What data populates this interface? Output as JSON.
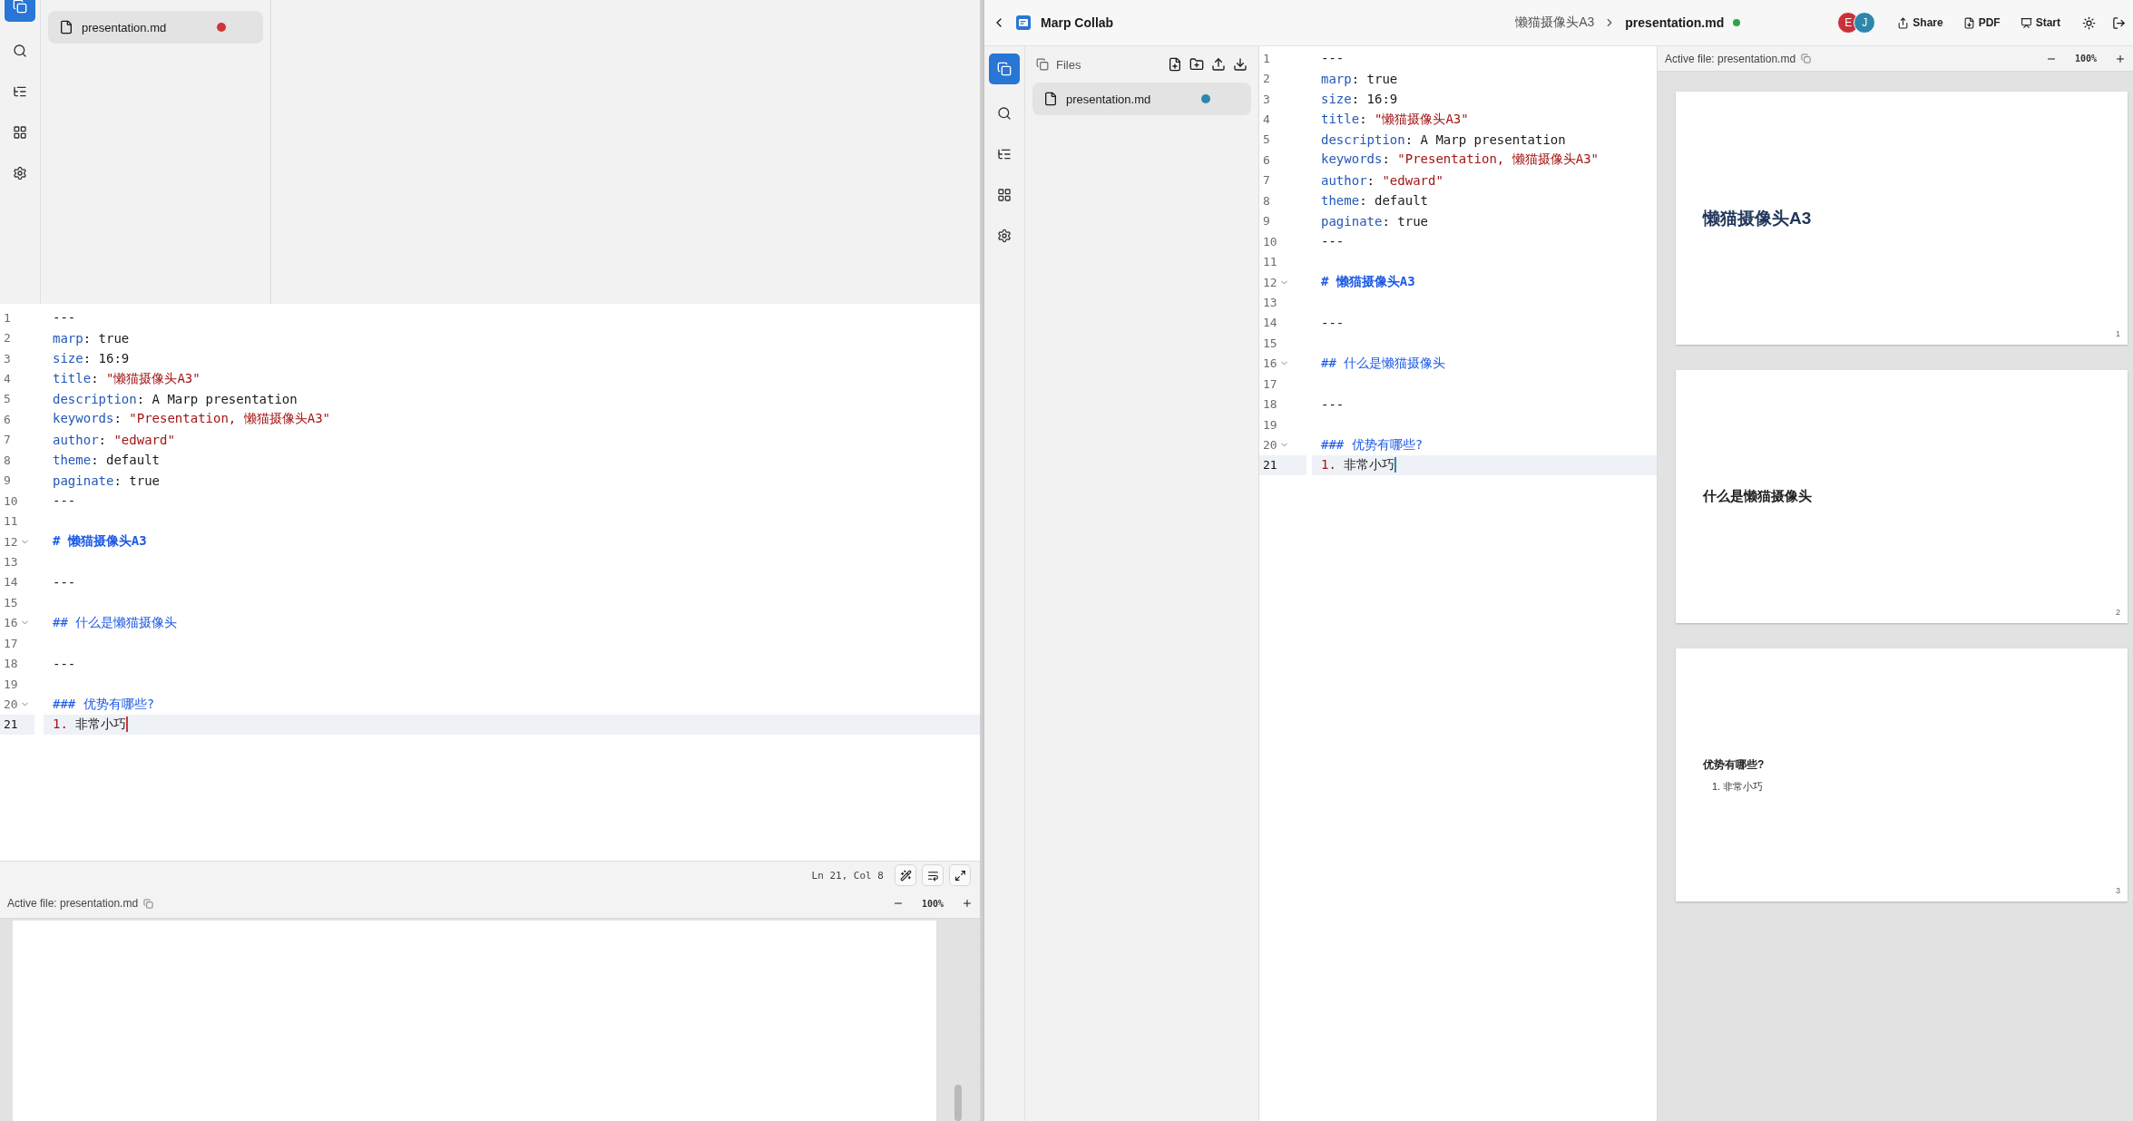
{
  "left_window": {
    "file_panel": {
      "files": [
        {
          "name": "presentation.md",
          "selected": true,
          "color": "#d13438"
        }
      ]
    },
    "editor": {
      "lines": [
        {
          "number": "1",
          "foldable": false,
          "active": false,
          "tokens": [
            {
              "kind": "plain",
              "text": "---"
            }
          ]
        },
        {
          "number": "2",
          "foldable": false,
          "active": false,
          "tokens": [
            {
              "kind": "key",
              "text": "marp"
            },
            {
              "kind": "plain",
              "text": ": true"
            }
          ]
        },
        {
          "number": "3",
          "foldable": false,
          "active": false,
          "tokens": [
            {
              "kind": "key",
              "text": "size"
            },
            {
              "kind": "plain",
              "text": ": 16:9"
            }
          ]
        },
        {
          "number": "4",
          "foldable": false,
          "active": false,
          "tokens": [
            {
              "kind": "key",
              "text": "title"
            },
            {
              "kind": "plain",
              "text": ": "
            },
            {
              "kind": "string",
              "text": "\"懒猫摄像头A3\""
            }
          ]
        },
        {
          "number": "5",
          "foldable": false,
          "active": false,
          "tokens": [
            {
              "kind": "key",
              "text": "description"
            },
            {
              "kind": "plain",
              "text": ": A Marp presentation"
            }
          ]
        },
        {
          "number": "6",
          "foldable": false,
          "active": false,
          "tokens": [
            {
              "kind": "key",
              "text": "keywords"
            },
            {
              "kind": "plain",
              "text": ": "
            },
            {
              "kind": "string",
              "text": "\"Presentation, 懒猫摄像头A3\""
            }
          ]
        },
        {
          "number": "7",
          "foldable": false,
          "active": false,
          "tokens": [
            {
              "kind": "key",
              "text": "author"
            },
            {
              "kind": "plain",
              "text": ": "
            },
            {
              "kind": "string",
              "text": "\"edward\""
            }
          ]
        },
        {
          "number": "8",
          "foldable": false,
          "active": false,
          "tokens": [
            {
              "kind": "key",
              "text": "theme"
            },
            {
              "kind": "plain",
              "text": ": default"
            }
          ]
        },
        {
          "number": "9",
          "foldable": false,
          "active": false,
          "tokens": [
            {
              "kind": "key",
              "text": "paginate"
            },
            {
              "kind": "plain",
              "text": ": true"
            }
          ]
        },
        {
          "number": "10",
          "foldable": false,
          "active": false,
          "tokens": [
            {
              "kind": "plain",
              "text": "---"
            }
          ]
        },
        {
          "number": "11",
          "foldable": false,
          "active": false
        },
        {
          "number": "12",
          "foldable": true,
          "active": false,
          "tokens": [
            {
              "kind": "heading_strong",
              "text": "# 懒猫摄像头A3"
            }
          ]
        },
        {
          "number": "13",
          "foldable": false,
          "active": false
        },
        {
          "number": "14",
          "foldable": false,
          "active": false,
          "tokens": [
            {
              "kind": "plain",
              "text": "---"
            }
          ]
        },
        {
          "number": "15",
          "foldable": false,
          "active": false
        },
        {
          "number": "16",
          "foldable": true,
          "active": false,
          "tokens": [
            {
              "kind": "heading",
              "text": "## 什么是懒猫摄像头"
            }
          ]
        },
        {
          "number": "17",
          "foldable": false,
          "active": false
        },
        {
          "number": "18",
          "foldable": false,
          "active": false,
          "tokens": [
            {
              "kind": "plain",
              "text": "---"
            }
          ]
        },
        {
          "number": "19",
          "foldable": false,
          "active": false
        },
        {
          "number": "20",
          "foldable": true,
          "active": false,
          "tokens": [
            {
              "kind": "heading",
              "text": "### 优势有哪些?"
            }
          ]
        },
        {
          "number": "21",
          "foldable": false,
          "active": true,
          "tokens": [
            {
              "kind": "listnum",
              "text": "1."
            },
            {
              "kind": "plain",
              "text": " 非常小巧"
            }
          ]
        }
      ]
    },
    "status_bar": {
      "position": "Ln 21, Col 8"
    },
    "preview": {
      "active_file": "Active file: presentation.md",
      "zoom": "100%"
    }
  },
  "right_window": {
    "app_title": "Marp Collab",
    "breadcrumb": {
      "folder": "懒猫摄像头A3",
      "file": "presentation.md"
    },
    "avatars": [
      {
        "initial": "E",
        "color": "#c8323a"
      },
      {
        "initial": "J",
        "color": "#2e86ab"
      }
    ],
    "actions": [
      {
        "kind": "share",
        "label": "Share"
      },
      {
        "kind": "pdf",
        "label": "PDF"
      },
      {
        "kind": "start",
        "label": "Start"
      }
    ],
    "file_panel": {
      "title": "Files",
      "files": [
        {
          "name": "presentation.md",
          "selected": true,
          "color": "#2e86ab"
        }
      ]
    },
    "editor": {
      "lines": [
        {
          "number": "1",
          "foldable": false,
          "active": false,
          "tokens": [
            {
              "kind": "plain",
              "text": "---"
            }
          ]
        },
        {
          "number": "2",
          "foldable": false,
          "active": false,
          "tokens": [
            {
              "kind": "key",
              "text": "marp"
            },
            {
              "kind": "plain",
              "text": ": true"
            }
          ]
        },
        {
          "number": "3",
          "foldable": false,
          "active": false,
          "tokens": [
            {
              "kind": "key",
              "text": "size"
            },
            {
              "kind": "plain",
              "text": ": 16:9"
            }
          ]
        },
        {
          "number": "4",
          "foldable": false,
          "active": false,
          "tokens": [
            {
              "kind": "key",
              "text": "title"
            },
            {
              "kind": "plain",
              "text": ": "
            },
            {
              "kind": "string",
              "text": "\"懒猫摄像头A3\""
            }
          ]
        },
        {
          "number": "5",
          "foldable": false,
          "active": false,
          "tokens": [
            {
              "kind": "key",
              "text": "description"
            },
            {
              "kind": "plain",
              "text": ": A Marp presentation"
            }
          ]
        },
        {
          "number": "6",
          "foldable": false,
          "active": false,
          "tokens": [
            {
              "kind": "key",
              "text": "keywords"
            },
            {
              "kind": "plain",
              "text": ": "
            },
            {
              "kind": "string",
              "text": "\"Presentation, 懒猫摄像头A3\""
            }
          ]
        },
        {
          "number": "7",
          "foldable": false,
          "active": false,
          "tokens": [
            {
              "kind": "key",
              "text": "author"
            },
            {
              "kind": "plain",
              "text": ": "
            },
            {
              "kind": "string",
              "text": "\"edward\""
            }
          ]
        },
        {
          "number": "8",
          "foldable": false,
          "active": false,
          "tokens": [
            {
              "kind": "key",
              "text": "theme"
            },
            {
              "kind": "plain",
              "text": ": default"
            }
          ]
        },
        {
          "number": "9",
          "foldable": false,
          "active": false,
          "tokens": [
            {
              "kind": "key",
              "text": "paginate"
            },
            {
              "kind": "plain",
              "text": ": true"
            }
          ]
        },
        {
          "number": "10",
          "foldable": false,
          "active": false,
          "tokens": [
            {
              "kind": "plain",
              "text": "---"
            }
          ]
        },
        {
          "number": "11",
          "foldable": false,
          "active": false
        },
        {
          "number": "12",
          "foldable": true,
          "active": false,
          "tokens": [
            {
              "kind": "heading_strong",
              "text": "# 懒猫摄像头A3"
            }
          ]
        },
        {
          "number": "13",
          "foldable": false,
          "active": false
        },
        {
          "number": "14",
          "foldable": false,
          "active": false,
          "tokens": [
            {
              "kind": "plain",
              "text": "---"
            }
          ]
        },
        {
          "number": "15",
          "foldable": false,
          "active": false
        },
        {
          "number": "16",
          "foldable": true,
          "active": false,
          "tokens": [
            {
              "kind": "heading",
              "text": "## 什么是懒猫摄像头"
            }
          ]
        },
        {
          "number": "17",
          "foldable": false,
          "active": false
        },
        {
          "number": "18",
          "foldable": false,
          "active": false,
          "tokens": [
            {
              "kind": "plain",
              "text": "---"
            }
          ]
        },
        {
          "number": "19",
          "foldable": false,
          "active": false
        },
        {
          "number": "20",
          "foldable": true,
          "active": false,
          "tokens": [
            {
              "kind": "heading",
              "text": "### 优势有哪些?"
            }
          ]
        },
        {
          "number": "21",
          "foldable": false,
          "active": true,
          "tokens": [
            {
              "kind": "listnum",
              "text": "1."
            },
            {
              "kind": "plain",
              "text": " 非常小巧"
            }
          ]
        }
      ]
    },
    "preview": {
      "active_file": "Active file: presentation.md",
      "zoom": "100%",
      "slides": [
        {
          "kind": "title",
          "title": "懒猫摄像头A3",
          "page": "1"
        },
        {
          "kind": "heading",
          "title": "什么是懒猫摄像头",
          "page": "2"
        },
        {
          "kind": "subheading",
          "title": "优势有哪些?",
          "items": [
            {
              "number": "1.",
              "text": "非常小巧"
            }
          ],
          "page": "3"
        }
      ]
    }
  }
}
